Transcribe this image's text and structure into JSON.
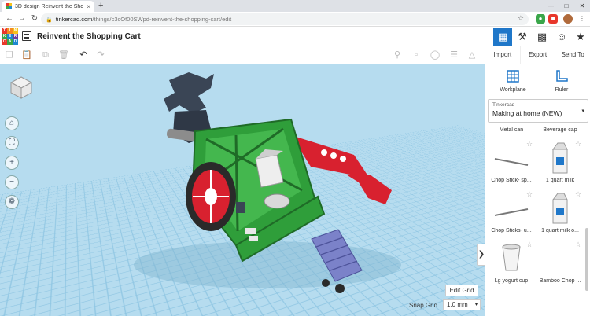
{
  "browser": {
    "tab_title": "3D design Reinvent the Shopping...",
    "tab_close": "×",
    "new_tab": "+",
    "url_host": "tinkercad.com",
    "url_path": "/things/c3cOf00SWpd-reinvent-the-shopping-cart/edit"
  },
  "app": {
    "design_title": "Reinvent the Shopping Cart",
    "logo_letters": [
      "T",
      "I",
      "N",
      "K",
      "E",
      "R",
      "C",
      "A",
      "D"
    ]
  },
  "actions": {
    "import": "Import",
    "export": "Export",
    "send_to": "Send To"
  },
  "panel": {
    "workplane_label": "Workplane",
    "ruler_label": "Ruler",
    "library_owner": "Tinkercad",
    "library_name": "Making at home (NEW)",
    "shapes": [
      {
        "label": "Metal can"
      },
      {
        "label": "Beverage cap"
      },
      {
        "label": "Chop Stick- sp..."
      },
      {
        "label": "1 quart milk"
      },
      {
        "label": "Chop Sticks- u..."
      },
      {
        "label": "1 quart milk o..."
      },
      {
        "label": "Lg yogurt cup"
      },
      {
        "label": "Bamboo Chop ..."
      }
    ]
  },
  "canvas": {
    "edit_grid": "Edit Grid",
    "snap_grid_label": "Snap Grid",
    "snap_grid_value": "1.0 mm"
  },
  "colors": {
    "accent": "#1f77c9",
    "workplane": "#b6dcef",
    "cart_green": "#2f9e3a",
    "wheel_red": "#d8212f",
    "logo": [
      "#e8372b",
      "#f58a1f",
      "#f5c21b",
      "#3aa64a",
      "#1e88d1",
      "#6a3fa0",
      "#e8372b",
      "#3aa64a",
      "#1e88d1"
    ]
  }
}
